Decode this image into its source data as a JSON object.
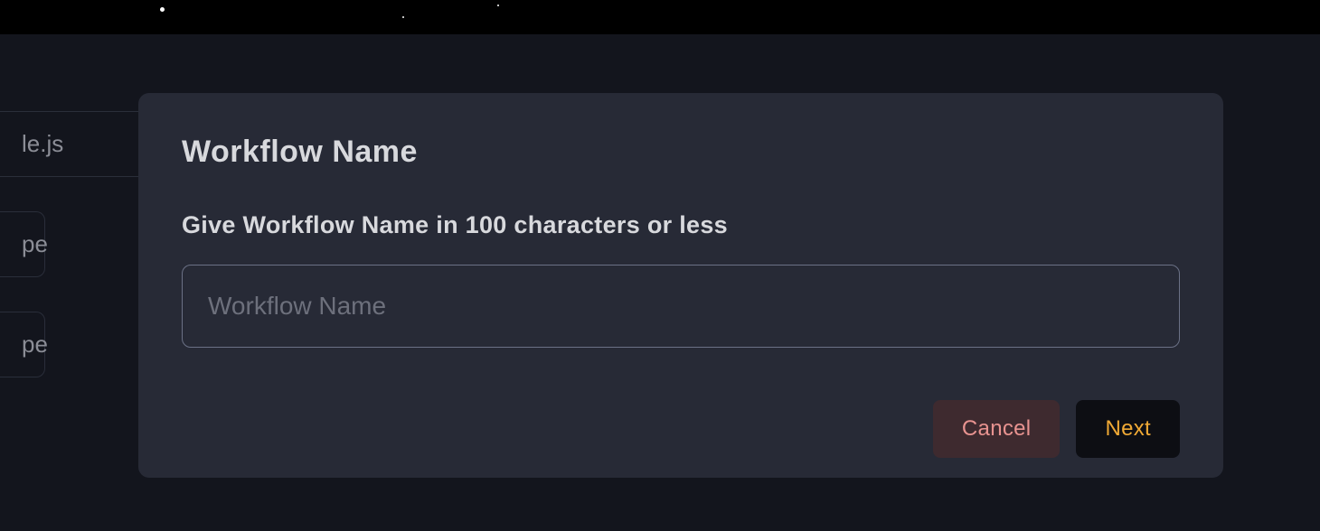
{
  "background": {
    "items": [
      "le.js",
      "pe",
      "pe"
    ]
  },
  "modal": {
    "title": "Workflow Name",
    "instruction": "Give Workflow Name in 100 characters or less",
    "input": {
      "placeholder": "Workflow Name",
      "value": ""
    },
    "buttons": {
      "cancel": "Cancel",
      "next": "Next"
    }
  }
}
